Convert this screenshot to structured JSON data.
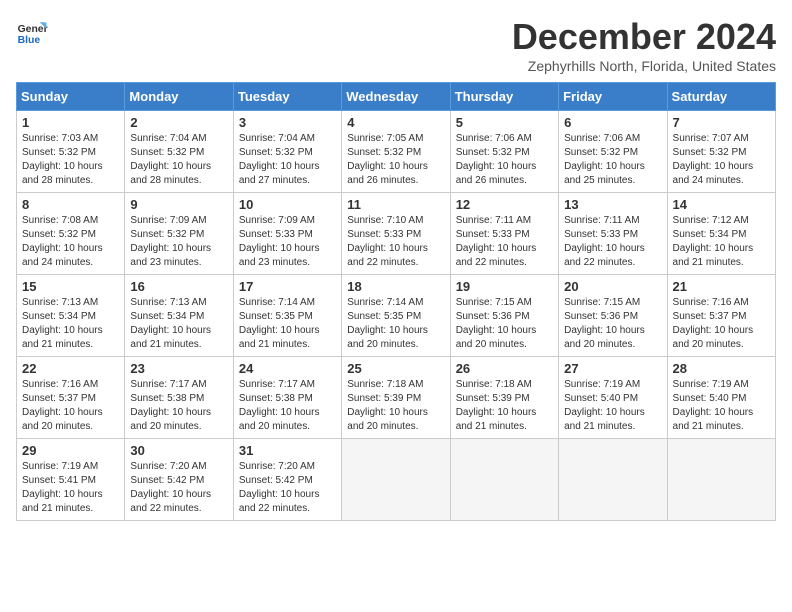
{
  "logo": {
    "line1": "General",
    "line2": "Blue"
  },
  "title": "December 2024",
  "subtitle": "Zephyrhills North, Florida, United States",
  "days_of_week": [
    "Sunday",
    "Monday",
    "Tuesday",
    "Wednesday",
    "Thursday",
    "Friday",
    "Saturday"
  ],
  "weeks": [
    [
      {
        "day": "1",
        "sunrise": "7:03 AM",
        "sunset": "5:32 PM",
        "daylight": "10 hours and 28 minutes."
      },
      {
        "day": "2",
        "sunrise": "7:04 AM",
        "sunset": "5:32 PM",
        "daylight": "10 hours and 28 minutes."
      },
      {
        "day": "3",
        "sunrise": "7:04 AM",
        "sunset": "5:32 PM",
        "daylight": "10 hours and 27 minutes."
      },
      {
        "day": "4",
        "sunrise": "7:05 AM",
        "sunset": "5:32 PM",
        "daylight": "10 hours and 26 minutes."
      },
      {
        "day": "5",
        "sunrise": "7:06 AM",
        "sunset": "5:32 PM",
        "daylight": "10 hours and 26 minutes."
      },
      {
        "day": "6",
        "sunrise": "7:06 AM",
        "sunset": "5:32 PM",
        "daylight": "10 hours and 25 minutes."
      },
      {
        "day": "7",
        "sunrise": "7:07 AM",
        "sunset": "5:32 PM",
        "daylight": "10 hours and 24 minutes."
      }
    ],
    [
      {
        "day": "8",
        "sunrise": "7:08 AM",
        "sunset": "5:32 PM",
        "daylight": "10 hours and 24 minutes."
      },
      {
        "day": "9",
        "sunrise": "7:09 AM",
        "sunset": "5:32 PM",
        "daylight": "10 hours and 23 minutes."
      },
      {
        "day": "10",
        "sunrise": "7:09 AM",
        "sunset": "5:33 PM",
        "daylight": "10 hours and 23 minutes."
      },
      {
        "day": "11",
        "sunrise": "7:10 AM",
        "sunset": "5:33 PM",
        "daylight": "10 hours and 22 minutes."
      },
      {
        "day": "12",
        "sunrise": "7:11 AM",
        "sunset": "5:33 PM",
        "daylight": "10 hours and 22 minutes."
      },
      {
        "day": "13",
        "sunrise": "7:11 AM",
        "sunset": "5:33 PM",
        "daylight": "10 hours and 22 minutes."
      },
      {
        "day": "14",
        "sunrise": "7:12 AM",
        "sunset": "5:34 PM",
        "daylight": "10 hours and 21 minutes."
      }
    ],
    [
      {
        "day": "15",
        "sunrise": "7:13 AM",
        "sunset": "5:34 PM",
        "daylight": "10 hours and 21 minutes."
      },
      {
        "day": "16",
        "sunrise": "7:13 AM",
        "sunset": "5:34 PM",
        "daylight": "10 hours and 21 minutes."
      },
      {
        "day": "17",
        "sunrise": "7:14 AM",
        "sunset": "5:35 PM",
        "daylight": "10 hours and 21 minutes."
      },
      {
        "day": "18",
        "sunrise": "7:14 AM",
        "sunset": "5:35 PM",
        "daylight": "10 hours and 20 minutes."
      },
      {
        "day": "19",
        "sunrise": "7:15 AM",
        "sunset": "5:36 PM",
        "daylight": "10 hours and 20 minutes."
      },
      {
        "day": "20",
        "sunrise": "7:15 AM",
        "sunset": "5:36 PM",
        "daylight": "10 hours and 20 minutes."
      },
      {
        "day": "21",
        "sunrise": "7:16 AM",
        "sunset": "5:37 PM",
        "daylight": "10 hours and 20 minutes."
      }
    ],
    [
      {
        "day": "22",
        "sunrise": "7:16 AM",
        "sunset": "5:37 PM",
        "daylight": "10 hours and 20 minutes."
      },
      {
        "day": "23",
        "sunrise": "7:17 AM",
        "sunset": "5:38 PM",
        "daylight": "10 hours and 20 minutes."
      },
      {
        "day": "24",
        "sunrise": "7:17 AM",
        "sunset": "5:38 PM",
        "daylight": "10 hours and 20 minutes."
      },
      {
        "day": "25",
        "sunrise": "7:18 AM",
        "sunset": "5:39 PM",
        "daylight": "10 hours and 20 minutes."
      },
      {
        "day": "26",
        "sunrise": "7:18 AM",
        "sunset": "5:39 PM",
        "daylight": "10 hours and 21 minutes."
      },
      {
        "day": "27",
        "sunrise": "7:19 AM",
        "sunset": "5:40 PM",
        "daylight": "10 hours and 21 minutes."
      },
      {
        "day": "28",
        "sunrise": "7:19 AM",
        "sunset": "5:40 PM",
        "daylight": "10 hours and 21 minutes."
      }
    ],
    [
      {
        "day": "29",
        "sunrise": "7:19 AM",
        "sunset": "5:41 PM",
        "daylight": "10 hours and 21 minutes."
      },
      {
        "day": "30",
        "sunrise": "7:20 AM",
        "sunset": "5:42 PM",
        "daylight": "10 hours and 22 minutes."
      },
      {
        "day": "31",
        "sunrise": "7:20 AM",
        "sunset": "5:42 PM",
        "daylight": "10 hours and 22 minutes."
      },
      null,
      null,
      null,
      null
    ]
  ]
}
